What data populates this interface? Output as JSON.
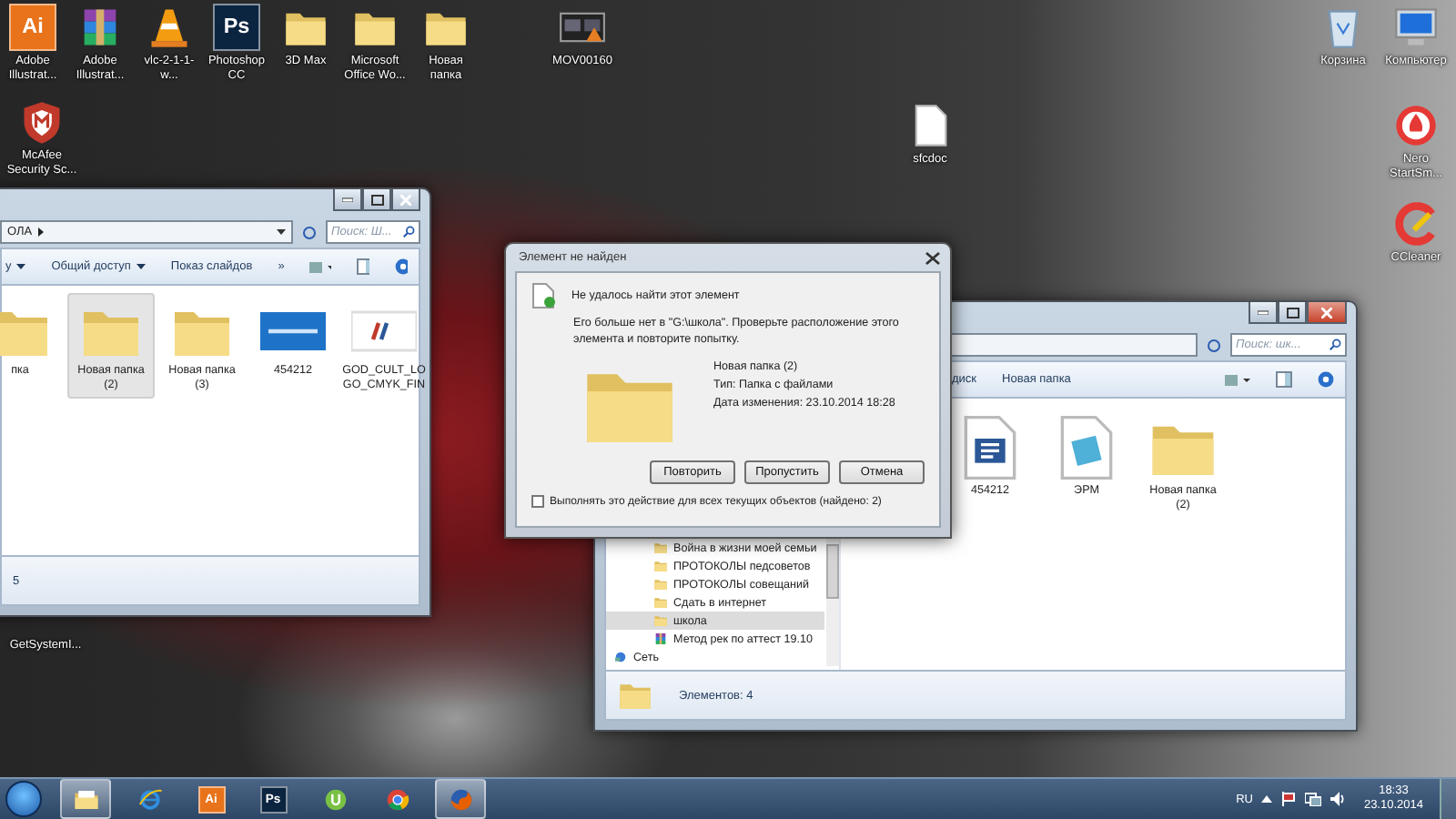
{
  "desktop_icons": [
    {
      "label": "Adobe Illustrat...",
      "kind": "tile",
      "glyph": "Ai",
      "color": "#e8731a"
    },
    {
      "label": "Adobe Illustrat...",
      "kind": "archive"
    },
    {
      "label": "vlc-2-1-1-w...",
      "kind": "cone"
    },
    {
      "label": "Photoshop CC",
      "kind": "tile",
      "glyph": "Ps",
      "color": "#0b2440"
    },
    {
      "label": "3D Max",
      "kind": "folder"
    },
    {
      "label": "Microsoft Office Wo...",
      "kind": "folder"
    },
    {
      "label": "Новая папка",
      "kind": "folder"
    },
    {
      "label": "MOV00160",
      "kind": "video"
    },
    {
      "label": "McAfee Security Sc...",
      "kind": "shield"
    },
    {
      "label": "Корзина",
      "kind": "trash"
    },
    {
      "label": "Компьютер",
      "kind": "monitor"
    },
    {
      "label": "Nero StartSm...",
      "kind": "flame"
    },
    {
      "label": "CCleaner",
      "kind": "brush"
    },
    {
      "label": "sfcdoc",
      "kind": "page"
    },
    {
      "label": "GetSystemI..."
    }
  ],
  "left_window": {
    "address": "ОЛА",
    "search": {
      "placeholder": "Поиск: Ш..."
    },
    "toolbar": [
      "у",
      "Общий доступ",
      "Показ слайдов",
      "»"
    ],
    "items": [
      {
        "label": "пка",
        "kind": "folder",
        "selected": false
      },
      {
        "label": "Новая папка (2)",
        "kind": "folder",
        "selected": true
      },
      {
        "label": "Новая папка (3)",
        "kind": "folder",
        "selected": false
      },
      {
        "label": "454212",
        "kind": "image",
        "selected": false
      },
      {
        "label": "GOD_CULT_LOGO_CMYK_FIN",
        "kind": "logo",
        "selected": false
      }
    ],
    "status": "5"
  },
  "dialog": {
    "title": "Элемент не найден",
    "heading": "Не удалось найти этот элемент",
    "message": "Его больше нет в \"G:\\школа\". Проверьте расположение этого элемента и повторите попытку.",
    "file": {
      "name": "Новая папка (2)",
      "type": "Тип: Папка с файлами",
      "date": "Дата изменения: 23.10.2014 18:28"
    },
    "buttons": [
      "Повторить",
      "Пропустить",
      "Отмена"
    ],
    "checkbox": {
      "label": "Выполнять это действие для всех текущих объектов (найдено: 2)",
      "checked": false
    }
  },
  "right_window": {
    "search": {
      "placeholder": "Поиск: шк..."
    },
    "toolbar": [
      "диск",
      "Новая папка"
    ],
    "nav": [
      {
        "label": "Война в жизни моей семьи",
        "kind": "folder",
        "selected": false
      },
      {
        "label": "ПРОТОКОЛЫ педсоветов",
        "kind": "folder",
        "selected": false
      },
      {
        "label": "ПРОТОКОЛЫ совещаний",
        "kind": "folder",
        "selected": false
      },
      {
        "label": "Сдать в интернет",
        "kind": "folder",
        "selected": false
      },
      {
        "label": "школа",
        "kind": "folder",
        "selected": true
      },
      {
        "label": "Метод рек по аттест 19.10",
        "kind": "archive",
        "selected": false
      },
      {
        "label": "Сеть",
        "kind": "network",
        "selected": false
      }
    ],
    "items": [
      {
        "label": "454212",
        "kind": "doc"
      },
      {
        "label": "ЭРМ",
        "kind": "notepad"
      },
      {
        "label": "Новая папка (2)",
        "kind": "folder"
      }
    ],
    "status": "Элементов: 4"
  },
  "taskbar": {
    "apps": [
      {
        "kind": "folders",
        "active": true
      },
      {
        "kind": "browser-e",
        "active": false
      },
      {
        "kind": "tile",
        "glyph": "Ai",
        "color": "#e8731a",
        "active": false
      },
      {
        "kind": "tile",
        "glyph": "Ps",
        "color": "#0b2440",
        "active": false
      },
      {
        "kind": "u-disc",
        "active": false
      },
      {
        "kind": "chrome",
        "active": false
      },
      {
        "kind": "fox",
        "active": true
      }
    ],
    "language": "RU",
    "time": "18:33",
    "date": "23.10.2014"
  }
}
